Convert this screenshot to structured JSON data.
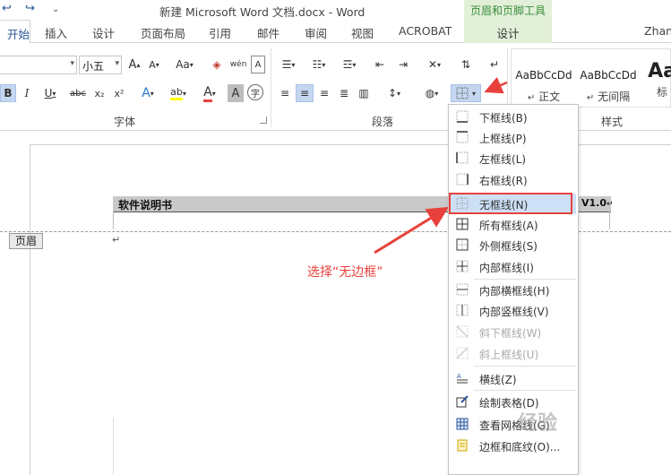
{
  "title_bar": {
    "doc_title": "新建 Microsoft Word 文档.docx - Word",
    "contextual_group": "页眉和页脚工具",
    "user": "Zhan"
  },
  "tabs": [
    {
      "label": "开始",
      "active": true
    },
    {
      "label": "插入"
    },
    {
      "label": "设计"
    },
    {
      "label": "页面布局"
    },
    {
      "label": "引用"
    },
    {
      "label": "邮件"
    },
    {
      "label": "审阅"
    },
    {
      "label": "视图"
    },
    {
      "label": "ACROBAT"
    },
    {
      "label": "设计",
      "contextual": true
    }
  ],
  "ribbon": {
    "font_size_value": "小五",
    "font_group_label": "字体",
    "paragraph_group_label": "段落",
    "styles_group_label": "样式",
    "styles": [
      {
        "sample": "AaBbCcDd",
        "name": "正文",
        "prefix": "↵"
      },
      {
        "sample": "AaBbCcDd",
        "name": "无间隔",
        "prefix": "↵"
      },
      {
        "sample": "Aa",
        "name": "标"
      }
    ],
    "button_labels": {
      "grow_font": "A",
      "shrink_font": "A",
      "change_case": "Aa",
      "wen": "wén",
      "bold": "B",
      "italic": "I",
      "underline": "U",
      "strikethrough": "abc",
      "subscript": "x₂",
      "superscript": "x²",
      "text_effects": "A",
      "highlight": "ab",
      "font_color": "A",
      "char_shading": "A",
      "enclose": "字"
    }
  },
  "document": {
    "header_title": "软件说明书",
    "header_version": "V1.0",
    "header_tag": "页眉",
    "para_mark": "↵",
    "annotation": "选择“无边框”"
  },
  "menu": {
    "items": [
      {
        "label": "下框线(B)",
        "icon": "bottom-border-icon"
      },
      {
        "label": "上框线(P)",
        "icon": "top-border-icon"
      },
      {
        "label": "左框线(L)",
        "icon": "left-border-icon"
      },
      {
        "label": "右框线(R)",
        "icon": "right-border-icon"
      },
      {
        "label": "无框线(N)",
        "icon": "no-border-icon",
        "highlighted": true
      },
      {
        "label": "所有框线(A)",
        "icon": "all-borders-icon"
      },
      {
        "label": "外侧框线(S)",
        "icon": "outside-borders-icon"
      },
      {
        "label": "内部框线(I)",
        "icon": "inside-borders-icon"
      },
      {
        "label": "内部横框线(H)",
        "icon": "inside-horizontal-border-icon"
      },
      {
        "label": "内部竖框线(V)",
        "icon": "inside-vertical-border-icon"
      },
      {
        "label": "斜下框线(W)",
        "icon": "diagonal-down-border-icon",
        "disabled": true
      },
      {
        "label": "斜上框线(U)",
        "icon": "diagonal-up-border-icon",
        "disabled": true
      },
      {
        "label": "横线(Z)",
        "icon": "horizontal-line-icon"
      },
      {
        "label": "绘制表格(D)",
        "icon": "draw-table-icon"
      },
      {
        "label": "查看网格线(G)",
        "icon": "view-gridlines-icon"
      },
      {
        "label": "边框和底纹(O)...",
        "icon": "borders-shading-icon"
      }
    ]
  },
  "watermark": "经验",
  "colors": {
    "accent": "#2b579a",
    "annotation_red": "#e8413c",
    "highlight_blue": "#cde0f7",
    "contextual_green": "#e2f0d9"
  }
}
